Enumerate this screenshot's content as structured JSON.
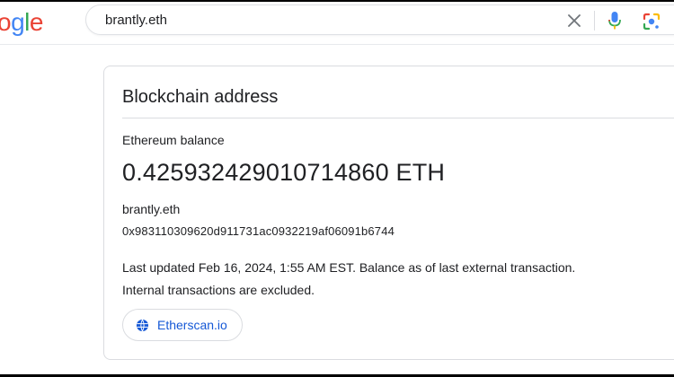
{
  "logo": {
    "letters": [
      {
        "ch": "o",
        "color": "#EA4335"
      },
      {
        "ch": "g",
        "color": "#4285F4"
      },
      {
        "ch": "l",
        "color": "#34A853"
      },
      {
        "ch": "e",
        "color": "#EA4335"
      }
    ]
  },
  "search": {
    "query": "brantly.eth",
    "clear_icon": "close-icon",
    "voice_icon": "mic-icon",
    "lens_icon": "google-lens-icon"
  },
  "card": {
    "title": "Blockchain address",
    "balance_label": "Ethereum balance",
    "balance_value": "0.425932429010714860 ETH",
    "ens_name": "brantly.eth",
    "address": "0x983110309620d911731ac0932219af06091b6744",
    "note_line1": "Last updated Feb 16, 2024, 1:55 AM EST. Balance as of last external transaction.",
    "note_line2": "Internal transactions are excluded.",
    "source_chip": {
      "label": "Etherscan.io",
      "icon": "globe-icon"
    }
  },
  "colors": {
    "link": "#1558D6",
    "border": "#DADCE0",
    "text": "#202124"
  }
}
